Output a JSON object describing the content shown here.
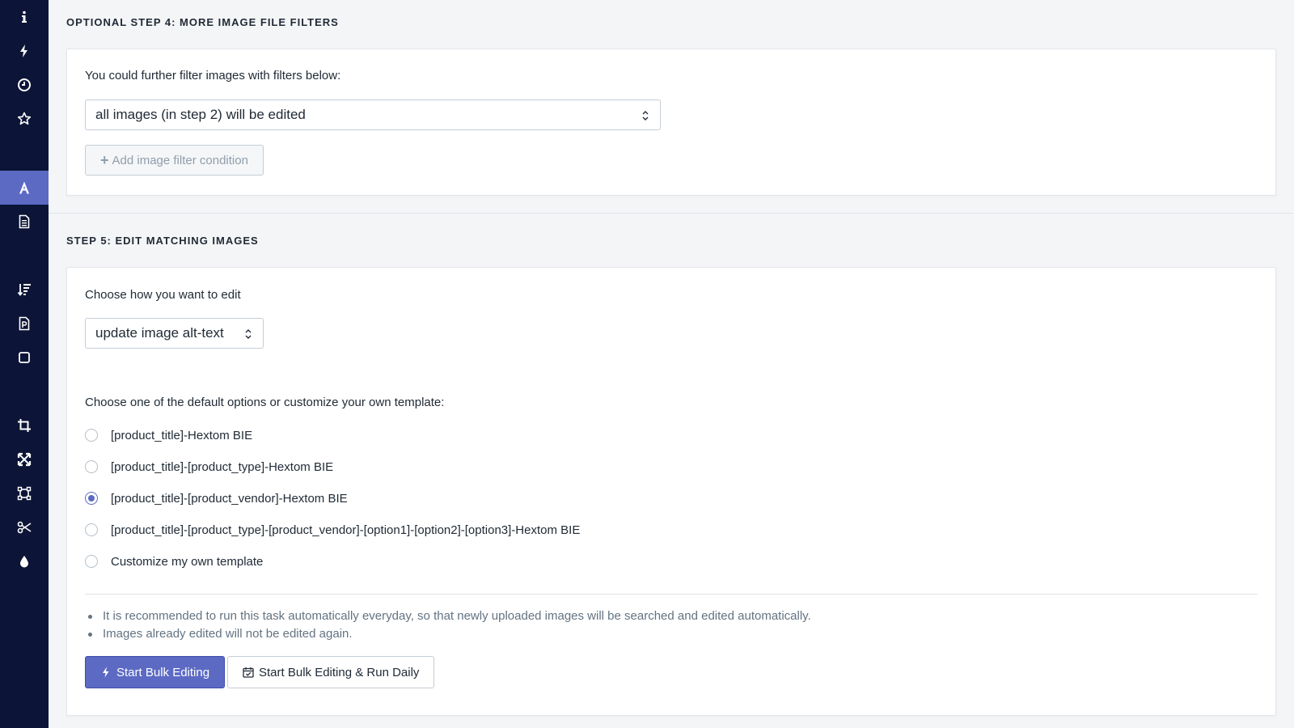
{
  "sidebar": {
    "items": [
      {
        "name": "info-icon",
        "active": false
      },
      {
        "name": "bolt-icon",
        "active": false
      },
      {
        "name": "clock-icon",
        "active": false
      },
      {
        "name": "star-icon",
        "active": false
      },
      {
        "name": "alt-text-icon",
        "active": true
      },
      {
        "name": "document-icon",
        "active": false
      },
      {
        "name": "sort-icon",
        "active": false
      },
      {
        "name": "file-p-icon",
        "active": false
      },
      {
        "name": "square-icon",
        "active": false
      },
      {
        "name": "crop-icon",
        "active": false
      },
      {
        "name": "expand-icon",
        "active": false
      },
      {
        "name": "resize-icon",
        "active": false
      },
      {
        "name": "scissors-icon",
        "active": false
      },
      {
        "name": "drop-icon",
        "active": false
      }
    ]
  },
  "step4": {
    "title": "OPTIONAL STEP 4: MORE IMAGE FILE FILTERS",
    "intro": "You could further filter images with filters below:",
    "select_value": "all images (in step 2) will be edited",
    "add_button": "Add image filter condition"
  },
  "step5": {
    "title": "STEP 5: EDIT MATCHING IMAGES",
    "how_label": "Choose how you want to edit",
    "how_value": "update image alt-text",
    "template_label": "Choose one of the default options or customize your own template:",
    "options": [
      {
        "label": "[product_title]-Hextom BIE",
        "checked": false
      },
      {
        "label": "[product_title]-[product_type]-Hextom BIE",
        "checked": false
      },
      {
        "label": "[product_title]-[product_vendor]-Hextom BIE",
        "checked": true
      },
      {
        "label": "[product_title]-[product_type]-[product_vendor]-[option1]-[option2]-[option3]-Hextom BIE",
        "checked": false
      },
      {
        "label": "Customize my own template",
        "checked": false
      }
    ],
    "notes": [
      "It is recommended to run this task automatically everyday, so that newly uploaded images will be searched and edited automatically.",
      "Images already edited will not be edited again."
    ],
    "start_button": "Start Bulk Editing",
    "start_daily_button": "Start Bulk Editing & Run Daily"
  },
  "colors": {
    "sidebar_bg": "#0c1537",
    "accent": "#5c6ac4",
    "page_bg": "#f4f5f7"
  }
}
